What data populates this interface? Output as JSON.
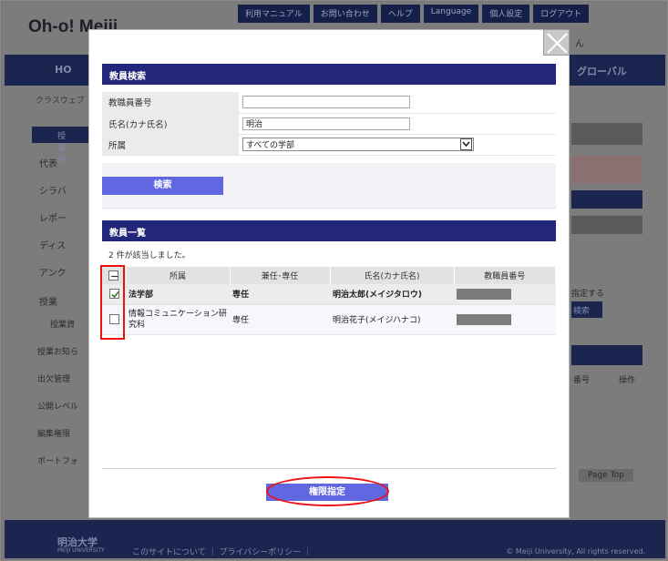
{
  "background": {
    "top_links": [
      "利用マニュアル",
      "お問い合わせ",
      "ヘルプ",
      "Language",
      "個人設定",
      "ログアウト"
    ],
    "logo": "Oh-o! Meiji",
    "user_suffix": "ん",
    "nav_home": "HO",
    "nav_global": "グローバル",
    "breadcrumb": "クラスウェブ ＞",
    "side_header": "授業管",
    "side_items": [
      "代表",
      "シラバ",
      "レポー",
      "ディス",
      "アンク",
      "授業"
    ],
    "side_sub": "授業資",
    "side_links": [
      "授業お知ら",
      "出欠管理",
      "公開レベル",
      "編集権限",
      "ポートフォ"
    ],
    "right_texts": [
      "指定する",
      "検索",
      "番号",
      "操作"
    ],
    "page_top": "Page Top",
    "footer_logo": "明治大学",
    "footer_logo_sub": "MEIJI UNIVERSITY",
    "footer_links": "このサイトについて ｜ プライバシーポリシー ｜",
    "footer_copy": "© Meiji University, All rights reserved."
  },
  "modal": {
    "search_section_title": "教員検索",
    "fields": [
      {
        "label": "教職員番号",
        "value": ""
      },
      {
        "label": "氏名(カナ氏名)",
        "value": "明治"
      },
      {
        "label": "所属",
        "value": "すべての学部"
      }
    ],
    "search_button": "検索",
    "list_section_title": "教員一覧",
    "result_count": "2 件が該当しました。",
    "columns": [
      "所属",
      "兼任･専任",
      "氏名(カナ氏名)",
      "教職員番号"
    ],
    "rows": [
      {
        "dept": "法学部",
        "type": "専任",
        "name": "明治太郎(メイジタロウ)",
        "checked": true
      },
      {
        "dept": "情報コミュニケーション研究科",
        "type": "専任",
        "name": "明治花子(メイジハナコ)",
        "checked": false
      }
    ],
    "authorize_button": "権限指定"
  },
  "colors": {
    "section_head": "#23277a",
    "button": "#6167e0",
    "highlight": "#ee1111"
  }
}
